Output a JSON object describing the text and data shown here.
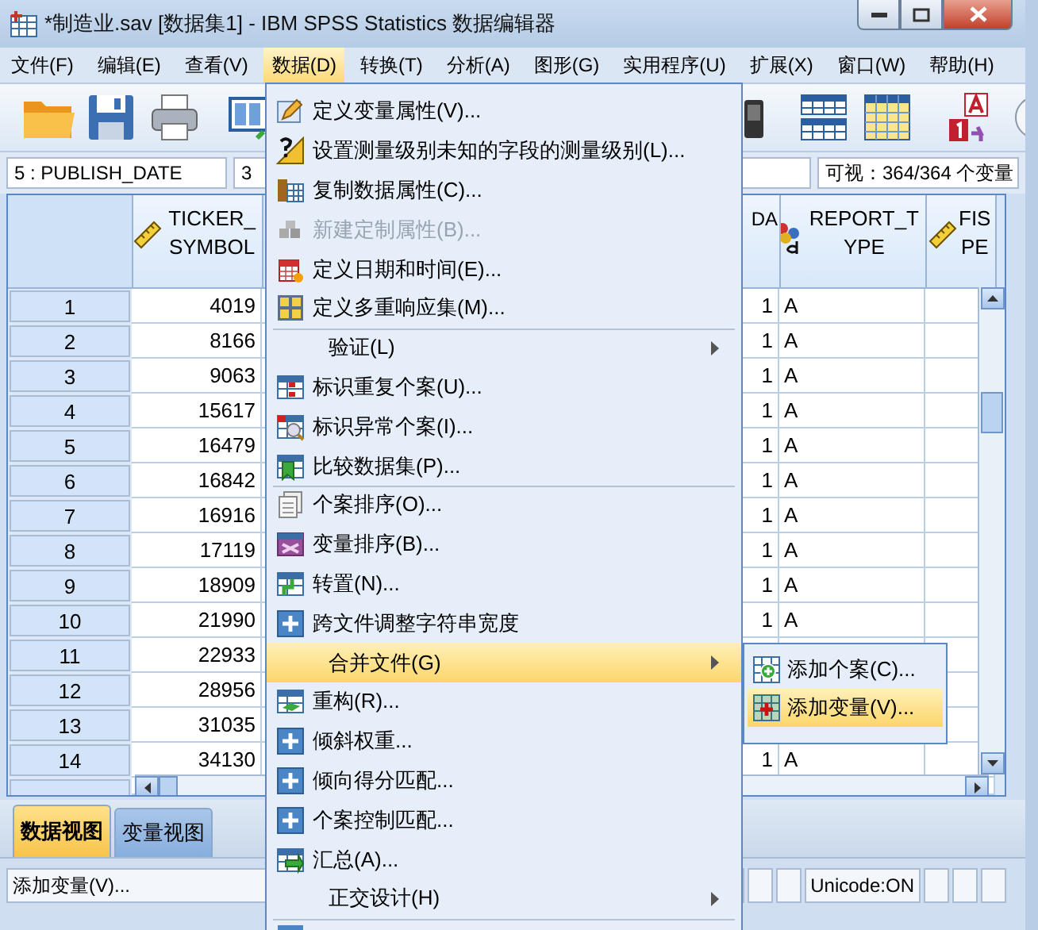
{
  "window": {
    "title": "*制造业.sav [数据集1] - IBM SPSS Statistics 数据编辑器"
  },
  "menubar": [
    {
      "label": "文件(F)",
      "selected": false
    },
    {
      "label": "编辑(E)",
      "selected": false
    },
    {
      "label": "查看(V)",
      "selected": false
    },
    {
      "label": "数据(D)",
      "selected": true
    },
    {
      "label": "转换(T)",
      "selected": false
    },
    {
      "label": "分析(A)",
      "selected": false
    },
    {
      "label": "图形(G)",
      "selected": false
    },
    {
      "label": "实用程序(U)",
      "selected": false
    },
    {
      "label": "扩展(X)",
      "selected": false
    },
    {
      "label": "窗口(W)",
      "selected": false
    },
    {
      "label": "帮助(H)",
      "selected": false
    }
  ],
  "cell_info": {
    "cell": "5 : PUBLISH_DATE",
    "value": "3",
    "visible": "可视：364/364 个变量"
  },
  "grid": {
    "columns": [
      {
        "label_lines": [
          "TICKER_",
          "SYMBOL"
        ],
        "kind": "scale"
      },
      {
        "label_lines": [
          "DA"
        ],
        "kind": "hidden"
      },
      {
        "label_lines": [
          "REPORT_T",
          "YPE"
        ],
        "kind": "string"
      },
      {
        "label_lines": [
          "FIS",
          "PE"
        ],
        "kind": "scale"
      }
    ],
    "rows": [
      {
        "number": "1",
        "cells": [
          "4019",
          "1",
          "A"
        ]
      },
      {
        "number": "2",
        "cells": [
          "8166",
          "1",
          "A"
        ]
      },
      {
        "number": "3",
        "cells": [
          "9063",
          "1",
          "A"
        ]
      },
      {
        "number": "4",
        "cells": [
          "15617",
          "1",
          "A"
        ]
      },
      {
        "number": "5",
        "cells": [
          "16479",
          "1",
          "A"
        ]
      },
      {
        "number": "6",
        "cells": [
          "16842",
          "1",
          "A"
        ]
      },
      {
        "number": "7",
        "cells": [
          "16916",
          "1",
          "A"
        ]
      },
      {
        "number": "8",
        "cells": [
          "17119",
          "1",
          "A"
        ]
      },
      {
        "number": "9",
        "cells": [
          "18909",
          "1",
          "A"
        ]
      },
      {
        "number": "10",
        "cells": [
          "21990",
          "1",
          "A"
        ]
      },
      {
        "number": "11",
        "cells": [
          "22933"
        ]
      },
      {
        "number": "12",
        "cells": [
          "28956"
        ]
      },
      {
        "number": "13",
        "cells": [
          "31035"
        ]
      },
      {
        "number": "14",
        "cells": [
          "34130",
          "1",
          "A"
        ]
      }
    ]
  },
  "view_tabs": [
    {
      "label": "数据视图",
      "selected": true
    },
    {
      "label": "变量视图",
      "selected": false
    }
  ],
  "status_bar": {
    "message": "添加变量(V)...",
    "indicator": "Unicode:ON"
  },
  "data_menu": [
    {
      "label": "定义变量属性(V)...",
      "kind": "command",
      "disabled": false,
      "selected": false,
      "separator_before": false
    },
    {
      "label": "设置测量级别未知的字段的测量级别(L)...",
      "kind": "command",
      "disabled": false,
      "selected": false,
      "separator_before": false
    },
    {
      "label": "复制数据属性(C)...",
      "kind": "command",
      "disabled": false,
      "selected": false,
      "separator_before": false
    },
    {
      "label": "新建定制属性(B)...",
      "kind": "command",
      "disabled": true,
      "selected": false,
      "separator_before": false
    },
    {
      "label": "定义日期和时间(E)...",
      "kind": "command",
      "disabled": false,
      "selected": false,
      "separator_before": false
    },
    {
      "label": "定义多重响应集(M)...",
      "kind": "command",
      "disabled": false,
      "selected": false,
      "separator_before": false
    },
    {
      "label": "验证(L)",
      "kind": "submenu",
      "disabled": false,
      "selected": false,
      "separator_before": true
    },
    {
      "label": "标识重复个案(U)...",
      "kind": "command",
      "disabled": false,
      "selected": false,
      "separator_before": false
    },
    {
      "label": "标识异常个案(I)...",
      "kind": "command",
      "disabled": false,
      "selected": false,
      "separator_before": false
    },
    {
      "label": "比较数据集(P)...",
      "kind": "command",
      "disabled": false,
      "selected": false,
      "separator_before": false
    },
    {
      "label": "个案排序(O)...",
      "kind": "command",
      "disabled": false,
      "selected": false,
      "separator_before": true
    },
    {
      "label": "变量排序(B)...",
      "kind": "command",
      "disabled": false,
      "selected": false,
      "separator_before": false
    },
    {
      "label": "转置(N)...",
      "kind": "command",
      "disabled": false,
      "selected": false,
      "separator_before": false
    },
    {
      "label": "跨文件调整字符串宽度",
      "kind": "command",
      "disabled": false,
      "selected": false,
      "separator_before": false
    },
    {
      "label": "合并文件(G)",
      "kind": "submenu",
      "disabled": false,
      "selected": true,
      "separator_before": false
    },
    {
      "label": "重构(R)...",
      "kind": "command",
      "disabled": false,
      "selected": false,
      "separator_before": false
    },
    {
      "label": "倾斜权重...",
      "kind": "command",
      "disabled": false,
      "selected": false,
      "separator_before": false
    },
    {
      "label": "倾向得分匹配...",
      "kind": "command",
      "disabled": false,
      "selected": false,
      "separator_before": false
    },
    {
      "label": "个案控制匹配...",
      "kind": "command",
      "disabled": false,
      "selected": false,
      "separator_before": false
    },
    {
      "label": "汇总(A)...",
      "kind": "command",
      "disabled": false,
      "selected": false,
      "separator_before": false
    },
    {
      "label": "正交设计(H)",
      "kind": "submenu",
      "disabled": false,
      "selected": false,
      "separator_before": false
    }
  ],
  "merge_submenu": [
    {
      "label": "添加个案(C)...",
      "selected": false
    },
    {
      "label": "添加变量(V)...",
      "selected": true
    }
  ]
}
